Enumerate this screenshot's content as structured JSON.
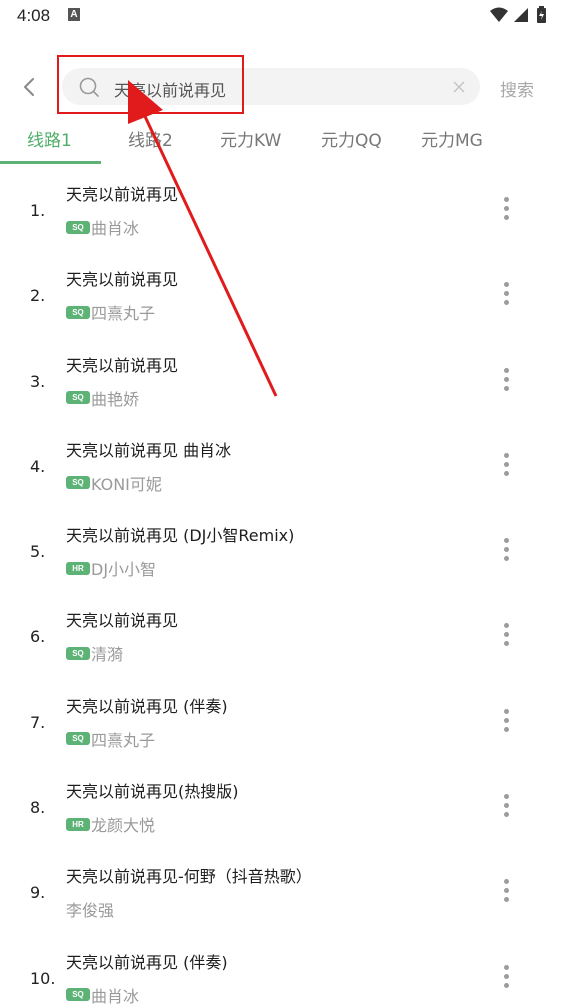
{
  "status_bar": {
    "time": "4:08",
    "notification_icon": "A"
  },
  "header": {
    "back_icon": "chevron-left",
    "search_value": "天亮以前说再见",
    "search_button_label": "搜索"
  },
  "tabs": [
    {
      "label": "线路1",
      "active": true
    },
    {
      "label": "线路2",
      "active": false
    },
    {
      "label": "元力KW",
      "active": false
    },
    {
      "label": "元力QQ",
      "active": false
    },
    {
      "label": "元力MG",
      "active": false
    }
  ],
  "songs": [
    {
      "num": "1.",
      "title": "天亮以前说再见",
      "badge": "SQ",
      "artist": "曲肖冰"
    },
    {
      "num": "2.",
      "title": "天亮以前说再见",
      "badge": "SQ",
      "artist": "四熹丸子"
    },
    {
      "num": "3.",
      "title": "天亮以前说再见",
      "badge": "SQ",
      "artist": "曲艳娇"
    },
    {
      "num": "4.",
      "title": "天亮以前说再见 曲肖冰",
      "badge": "SQ",
      "artist": "KONI可妮"
    },
    {
      "num": "5.",
      "title": "天亮以前说再见 (DJ小智Remix)",
      "badge": "HR",
      "artist": "DJ小小智"
    },
    {
      "num": "6.",
      "title": "天亮以前说再见",
      "badge": "SQ",
      "artist": "清漪"
    },
    {
      "num": "7.",
      "title": "天亮以前说再见 (伴奏)",
      "badge": "SQ",
      "artist": "四熹丸子"
    },
    {
      "num": "8.",
      "title": "天亮以前说再见(热搜版)",
      "badge": "HR",
      "artist": "龙颜大悦"
    },
    {
      "num": "9.",
      "title": "天亮以前说再见-何野（抖音热歌）",
      "badge": "",
      "artist": "李俊强"
    },
    {
      "num": "10.",
      "title": "天亮以前说再见 (伴奏)",
      "badge": "SQ",
      "artist": "曲肖冰"
    }
  ],
  "colors": {
    "accent": "#4fae6a",
    "badge": "#5db276",
    "annotation": "#e11b1b"
  }
}
